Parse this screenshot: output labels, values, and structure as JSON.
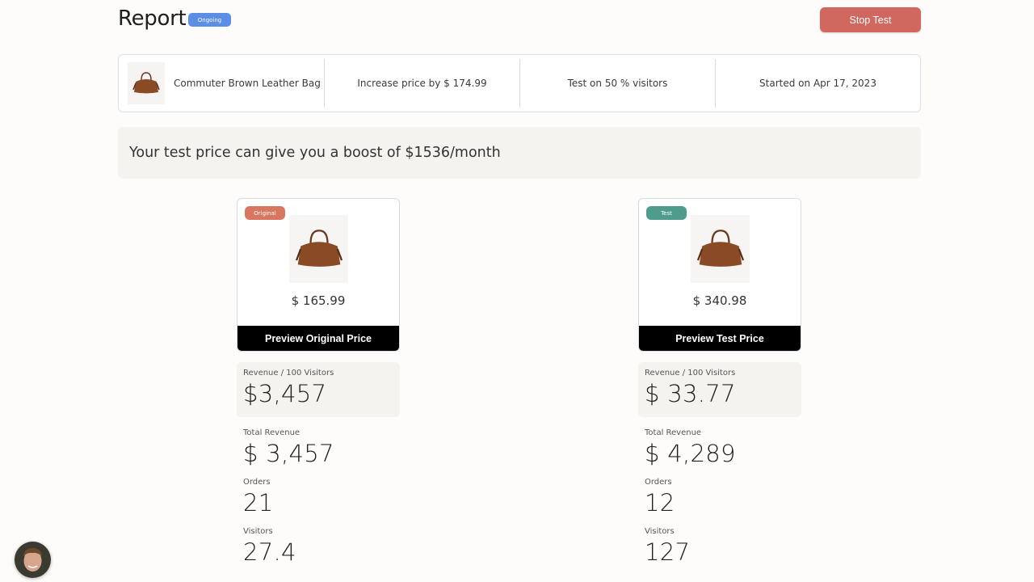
{
  "header": {
    "title": "Report",
    "status": "Ongoing",
    "stop_button": "Stop Test"
  },
  "info": {
    "product_name": "Commuter Brown Leather Bag",
    "price_change": "Increase price by $ 174.99",
    "audience": "Test on 50 % visitors",
    "started": "Started on Apr 17, 2023"
  },
  "boost_message": "Your test price can give you a boost of $1536/month",
  "variants": [
    {
      "tag": "Original",
      "tag_color": "#d9765f",
      "price": "$ 165.99",
      "preview_button": "Preview Original Price",
      "metrics": {
        "rev_per_100_label": "Revenue / 100 Visitors",
        "rev_per_100": "$3,457",
        "total_revenue_label": "Total Revenue",
        "total_revenue": "$ 3,457",
        "orders_label": "Orders",
        "orders": "21",
        "visitors_label": "Visitors",
        "visitors": "27.4"
      }
    },
    {
      "tag": "Test",
      "tag_color": "#4f9b8c",
      "price": "$ 340.98",
      "preview_button": "Preview Test Price",
      "metrics": {
        "rev_per_100_label": "Revenue / 100 Visitors",
        "rev_per_100": "$ 33.77",
        "total_revenue_label": "Total Revenue",
        "total_revenue": "$ 4,289",
        "orders_label": "Orders",
        "orders": "12",
        "visitors_label": "Visitors",
        "visitors": "127"
      }
    }
  ],
  "colors": {
    "status_badge": "#5b8fe6",
    "stop_button": "#d1685f",
    "preview_button": "#000000"
  }
}
